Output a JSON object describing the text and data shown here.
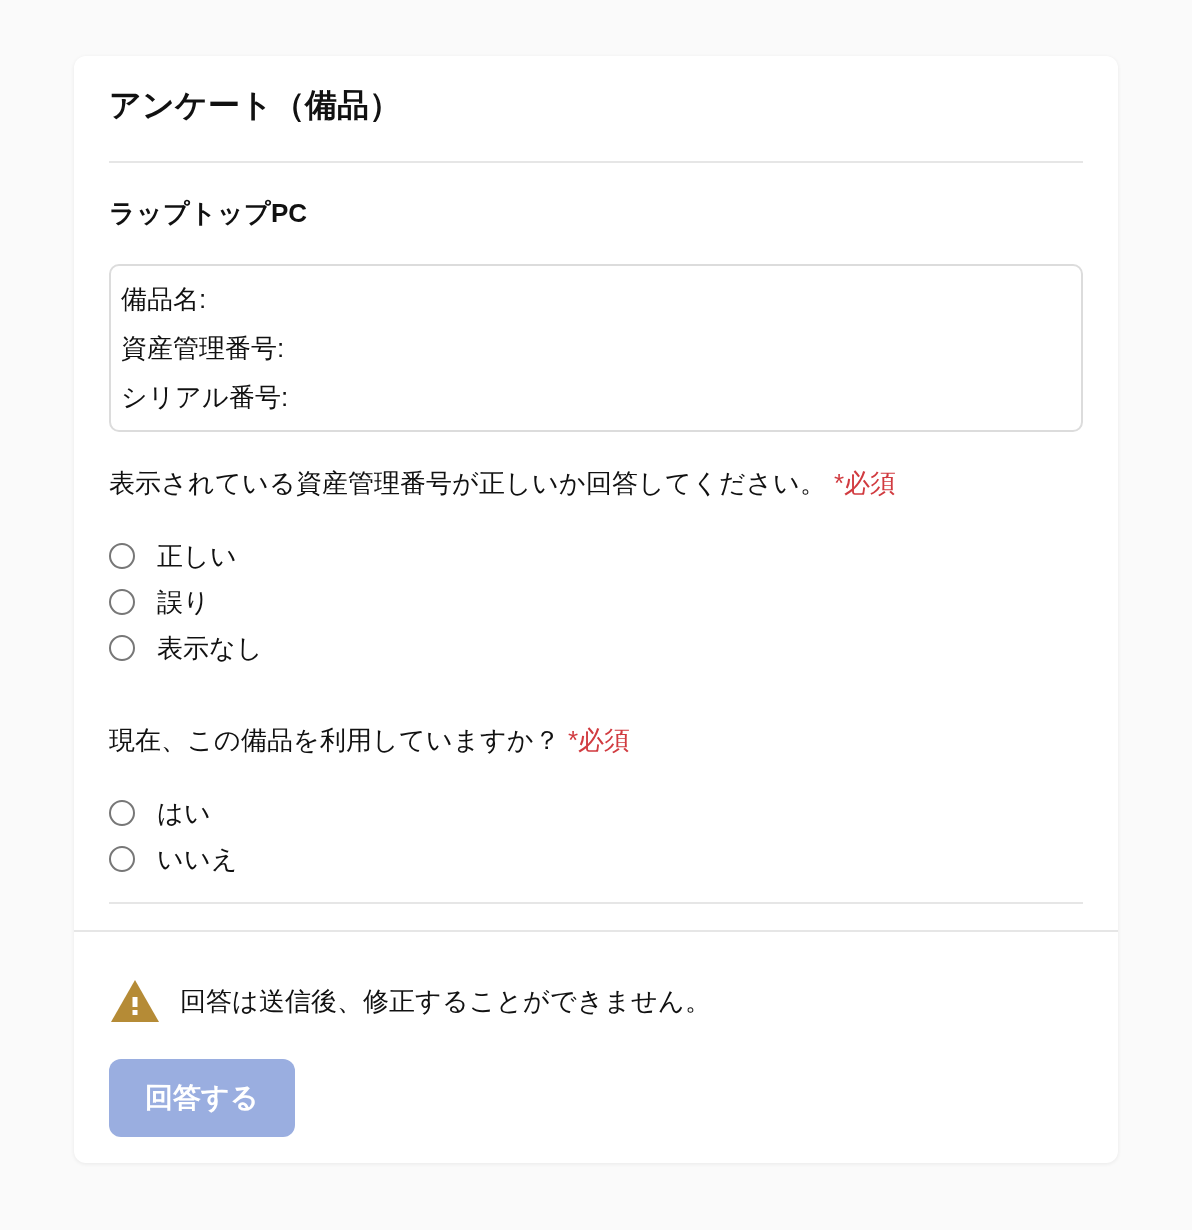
{
  "survey": {
    "title": "アンケート（備品）",
    "section_title": "ラップトップPC",
    "info_box": {
      "lines": [
        "備品名:",
        "資産管理番号:",
        "シリアル番号:"
      ]
    },
    "questions": [
      {
        "text": "表示されている資産管理番号が正しいか回答してください。",
        "required_label": "*必須",
        "options": [
          {
            "label": "正しい",
            "selected": false
          },
          {
            "label": "誤り",
            "selected": false
          },
          {
            "label": "表示なし",
            "selected": false
          }
        ]
      },
      {
        "text": "現在、この備品を利用していますか？",
        "required_label": "*必須",
        "options": [
          {
            "label": "はい",
            "selected": false
          },
          {
            "label": "いいえ",
            "selected": false
          }
        ]
      }
    ]
  },
  "footer": {
    "warning": "回答は送信後、修正することができません。",
    "submit_button": {
      "label": "回答する",
      "disabled": true
    }
  }
}
